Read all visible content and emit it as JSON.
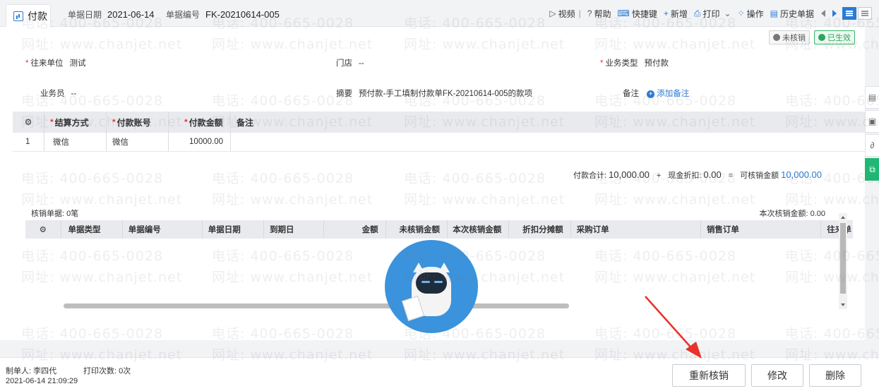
{
  "header": {
    "tab_title": "付款",
    "date_label": "单据日期",
    "date_value": "2021-06-14",
    "number_label": "单据编号",
    "number_value": "FK-20210614-005"
  },
  "toolbar": {
    "video": "视频",
    "help": "帮助",
    "shortcut": "快捷键",
    "add": "新增",
    "print": "打印",
    "operation": "操作",
    "history": "历史单据"
  },
  "status": {
    "unverified": "未核销",
    "effective": "已生效"
  },
  "form": {
    "partner_label": "往来单位",
    "partner_value": "测试",
    "store_label": "门店",
    "store_value": "--",
    "biz_type_label": "业务类型",
    "biz_type_value": "预付款",
    "salesman_label": "业务员",
    "salesman_value": "--",
    "summary_label": "摘要",
    "summary_value": "预付款-手工填制付款单FK-20210614-005的款项",
    "remark_label": "备注",
    "add_remark": "添加备注"
  },
  "settlement_table": {
    "columns": [
      "结算方式",
      "付款账号",
      "付款金额",
      "备注"
    ],
    "rows": [
      {
        "index": "1",
        "method": "微信",
        "account": "微信",
        "amount": "10000.00",
        "remark": ""
      }
    ]
  },
  "totals": {
    "payment_total_label": "付款合计:",
    "payment_total": "10,000.00",
    "plus": "+",
    "cash_discount_label": "现金折扣:",
    "cash_discount": "0.00",
    "equals": "=",
    "verifiable_label": "可核销金额",
    "verifiable": "10,000.00"
  },
  "verification": {
    "count_text": "核销单据: 0笔",
    "amount_text": "本次核销金额: 0.00",
    "columns": [
      "单据类型",
      "单据编号",
      "单据日期",
      "到期日",
      "金额",
      "未核销金额",
      "本次核销金额",
      "折扣分摊额",
      "采购订单",
      "销售订单",
      "往来单"
    ]
  },
  "footer": {
    "maker": "制单人: 李四代",
    "print_count": "打印次数: 0次",
    "made_time": "2021-06-14 21:09:29",
    "reverify_btn": "重新核销",
    "modify_btn": "修改",
    "delete_btn": "删除"
  },
  "watermark": {
    "phone": "电话: 400-665-0028",
    "site": "网址: www.chanjet.net"
  },
  "colors": {
    "accent": "#2b7bd6",
    "required": "#e23b3b",
    "effective": "#2ea45f",
    "annotation_arrow": "#e8322b"
  }
}
